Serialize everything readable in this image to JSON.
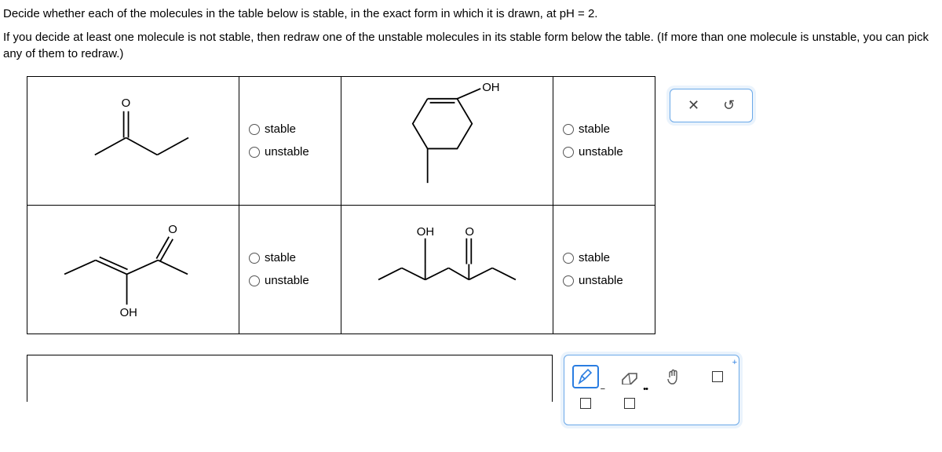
{
  "question": {
    "line1": "Decide whether each of the molecules in the table below is stable, in the exact form in which it is drawn, at pH = 2.",
    "line2": "If you decide at least one molecule is not stable, then redraw one of the unstable molecules in its stable form below the table. (If more than one molecule is unstable, you can pick any of them to redraw.)"
  },
  "options": {
    "stable": "stable",
    "unstable": "unstable"
  },
  "labels": {
    "O": "O",
    "OH": "OH"
  },
  "side": {
    "close": "✕",
    "undo": "↺"
  },
  "tools": {
    "pencil": "pencil-icon",
    "eraser": "eraser-icon",
    "hand": "hand-icon",
    "new": "new-icon",
    "anion": "anion-icon",
    "lonepair": "lonepair-icon"
  }
}
